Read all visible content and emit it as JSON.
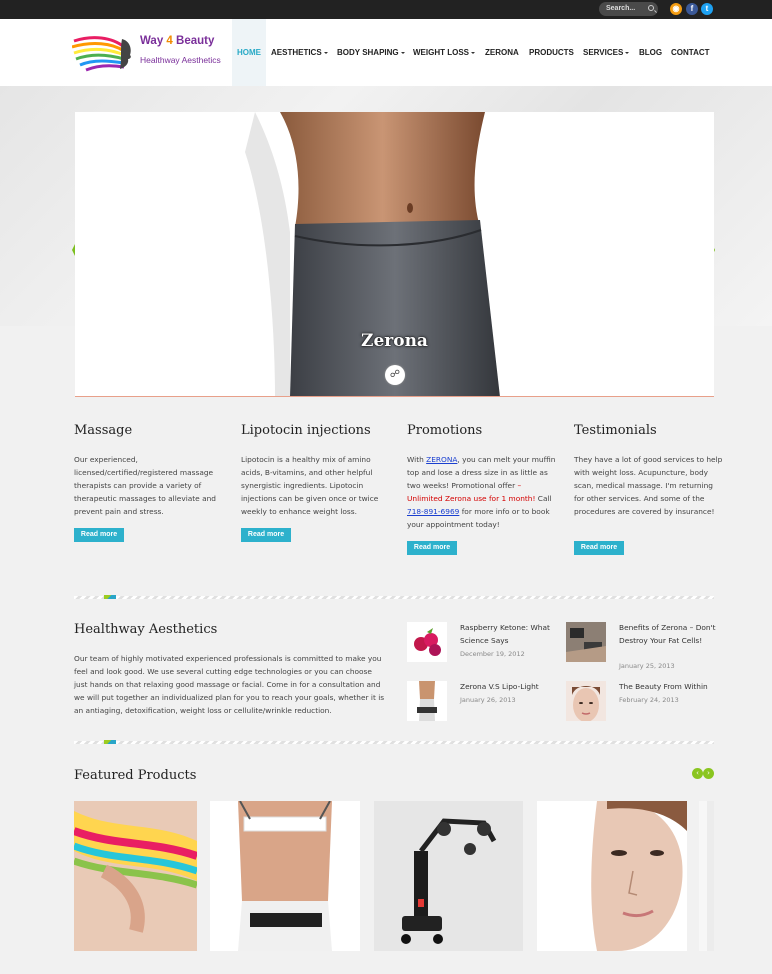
{
  "topbar": {
    "search_placeholder": "Search...",
    "social": [
      {
        "icon": "rss-icon",
        "glyph": "◉",
        "color": "#f39c12"
      },
      {
        "icon": "facebook-icon",
        "glyph": "f",
        "color": "#3b5998"
      },
      {
        "icon": "twitter-icon",
        "glyph": "t",
        "color": "#1da1f2"
      }
    ]
  },
  "header": {
    "logo_text_a": "Way ",
    "logo_text_num": "4",
    "logo_text_b": " Beauty",
    "logo_tagline": "Healthway Aesthetics",
    "nav": [
      {
        "label": "HOME",
        "active": true,
        "dropdown": false
      },
      {
        "label": "AESTHETICS",
        "active": false,
        "dropdown": true
      },
      {
        "label": "BODY SHAPING",
        "active": false,
        "dropdown": true
      },
      {
        "label": "WEIGHT LOSS",
        "active": false,
        "dropdown": true
      },
      {
        "label": "ZERONA",
        "active": false,
        "dropdown": false
      },
      {
        "label": "PRODUCTS",
        "active": false,
        "dropdown": false
      },
      {
        "label": "SERVICES",
        "active": false,
        "dropdown": true
      },
      {
        "label": "BLOG",
        "active": false,
        "dropdown": false
      },
      {
        "label": "CONTACT",
        "active": false,
        "dropdown": false
      }
    ]
  },
  "slider": {
    "title": "Zerona",
    "link_icon": "link-icon",
    "prev_icon": "arrow-left-icon",
    "next_icon": "arrow-right-icon"
  },
  "features": [
    {
      "title": "Massage",
      "text": "Our experienced, licensed/certified/registered massage therapists can provide a variety of therapeutic massages to alleviate and prevent pain and stress.",
      "button": "Read more"
    },
    {
      "title": "Lipotocin injections",
      "text": "Lipotocin is a healthy mix of amino acids, B-vitamins, and other helpful synergistic ingredients. Lipotocin injections can be given once or twice weekly to enhance weight loss.",
      "button": "Read more"
    },
    {
      "title": "Promotions",
      "text_a": "With ",
      "text_link": "ZERONA",
      "text_b": ", you can melt your muffin top and lose a dress size in as little as two weeks! Promotional offer ",
      "text_red": "– Unlimited Zerona use for 1 month!",
      "text_c": " Call ",
      "phone": "718-891-6969",
      "text_d": " for more info or to book your appointment today!",
      "button": "Read more"
    },
    {
      "title": "Testimonials",
      "text": "They have a lot of good services to help with weight loss. Acupuncture, body scan, medical massage. I'm returning for other services. And some of the procedures are covered by insurance!",
      "button": "Read more"
    }
  ],
  "about": {
    "title": "Healthway Aesthetics",
    "text": "Our team of highly motivated experienced professionals is committed to make you feel and look good. We use several cutting edge technologies or you can choose just hands on that relaxing good massage or facial. Come in for a consultation and we will put together an individualized plan for you to reach your goals, whether it is an antiaging, detoxification, weight loss or cellulite/wrinkle reduction."
  },
  "posts": [
    {
      "title": "Raspberry Ketone: What Science Says",
      "date": "December 19, 2012"
    },
    {
      "title": "Benefits of Zerona – Don't Destroy Your Fat Cells!",
      "date": "January 25, 2013"
    },
    {
      "title": "Zerona V.S Lipo-Light",
      "date": "January 26, 2013"
    },
    {
      "title": "The Beauty From Within",
      "date": "February 24, 2013"
    }
  ],
  "featured": {
    "title": "Featured Products",
    "prev_icon": "chevron-left-icon",
    "next_icon": "chevron-right-icon",
    "prev_glyph": "‹",
    "next_glyph": "›"
  },
  "colors": {
    "accent": "#2db1cc",
    "green": "#8ac520",
    "dark": "#222222"
  }
}
